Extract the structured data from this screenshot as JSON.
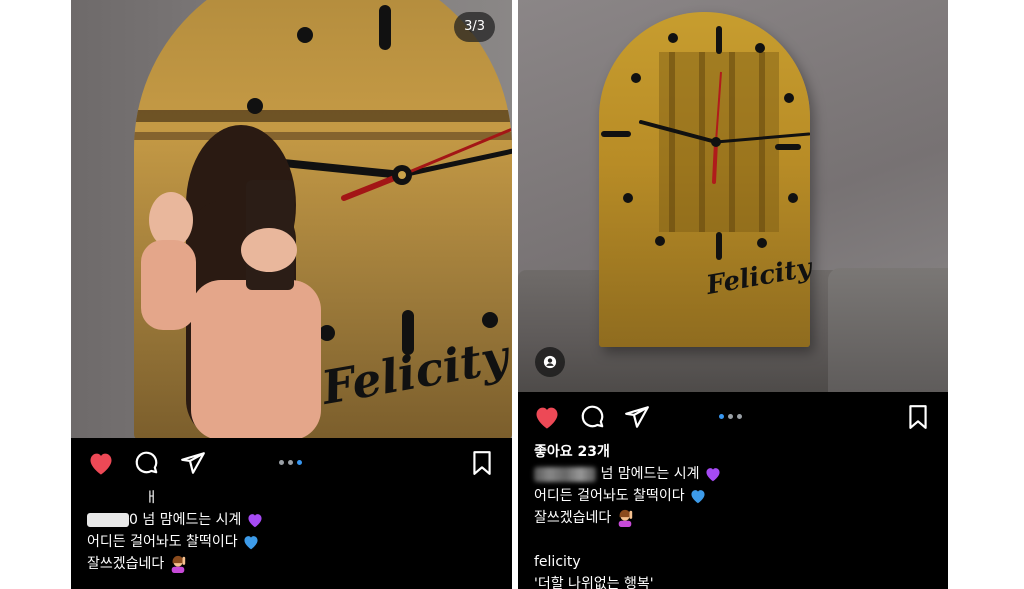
{
  "left_post": {
    "counter": "3/3",
    "signature": "Felicity",
    "caption_lines": [
      "ㅐ",
      "넘 맘에드는 시계",
      "어디든 걸어놔도 찰떡이다",
      "잘쓰겠습네다"
    ],
    "caption_partial_prefix": "0",
    "emojis": [
      "purple-heart",
      "blue-heart",
      "person-raising-hand"
    ]
  },
  "right_post": {
    "signature": "Felicity",
    "likes": "좋아요 23개",
    "caption_lines": [
      "넘 맘에드는 시계",
      "어디든 걸어놔도 찰떡이다",
      "잘쓰겠습네다",
      "felicity",
      "'더할 나위없는 행복'"
    ],
    "emojis": [
      "purple-heart",
      "blue-heart",
      "person-raising-hand"
    ]
  },
  "colors": {
    "like_heart": "#ed4956",
    "carousel_active": "#3897f0",
    "carousel_inactive": "#9aa0a6",
    "feed_background": "#000000",
    "mirror_gold": "#c59a45"
  },
  "icons": {
    "like": "heart-icon",
    "comment": "comment-icon",
    "share": "send-icon",
    "save": "bookmark-icon",
    "user_tag": "user-tag-icon"
  }
}
